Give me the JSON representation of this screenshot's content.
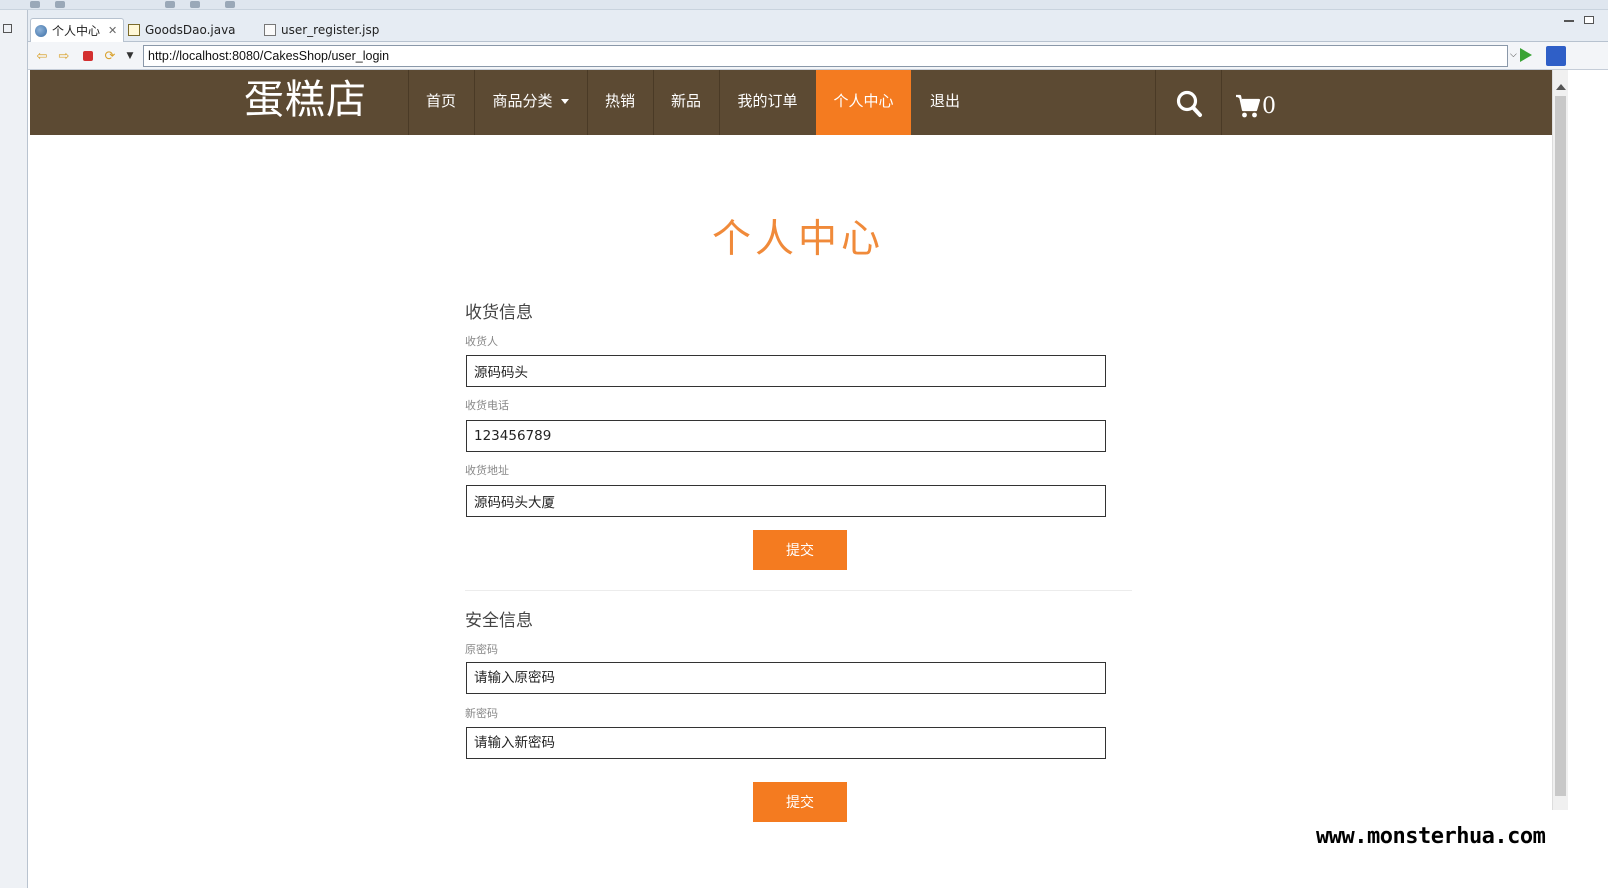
{
  "editor": {
    "tabs": [
      {
        "label": "个人中心",
        "active": true,
        "icon": "globe-icon"
      },
      {
        "label": "GoodsDao.java",
        "active": false,
        "icon": "java-file-icon"
      },
      {
        "label": "user_register.jsp",
        "active": false,
        "icon": "jsp-file-icon"
      }
    ]
  },
  "browser": {
    "url": "http://localhost:8080/CakesShop/user_login"
  },
  "site": {
    "logo": "蛋糕店",
    "nav": {
      "home": "首页",
      "categories": "商品分类",
      "hot": "热销",
      "new": "新品",
      "orders": "我的订单",
      "profile": "个人中心",
      "logout": "退出"
    },
    "cart_count": "0",
    "accent_color": "#f47b20",
    "nav_bg_color": "#5c4a33"
  },
  "profile": {
    "title": "个人中心",
    "shipping": {
      "title": "收货信息",
      "receiver_label": "收货人",
      "receiver_value": "源码码头",
      "phone_label": "收货电话",
      "phone_value": "123456789",
      "address_label": "收货地址",
      "address_value": "源码码头大厦",
      "submit_label": "提交"
    },
    "security": {
      "title": "安全信息",
      "old_password_label": "原密码",
      "old_password_placeholder": "请输入原密码",
      "new_password_label": "新密码",
      "new_password_placeholder": "请输入新密码",
      "submit_label": "提交"
    }
  },
  "watermark": "www.monsterhua.com"
}
